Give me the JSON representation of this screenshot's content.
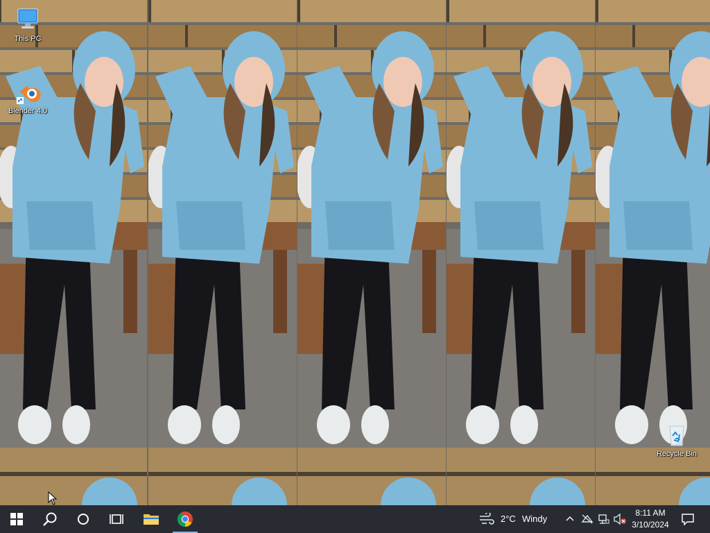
{
  "desktop": {
    "icons": [
      {
        "label": "This PC",
        "icon": "this-pc-icon"
      },
      {
        "label": "Blender 4.0",
        "icon": "blender-icon"
      },
      {
        "label": "Recycle Bin",
        "icon": "recycle-bin-icon"
      }
    ]
  },
  "taskbar": {
    "pinned": [
      {
        "name": "start-button",
        "icon": "windows-logo-icon"
      },
      {
        "name": "search-button",
        "icon": "search-icon"
      },
      {
        "name": "cortana-button",
        "icon": "cortana-circle-icon"
      },
      {
        "name": "task-view-button",
        "icon": "task-view-icon"
      },
      {
        "name": "file-explorer-button",
        "icon": "folder-icon"
      },
      {
        "name": "chrome-button",
        "icon": "chrome-icon"
      }
    ],
    "weather": {
      "temperature": "2°C",
      "condition": "Windy"
    },
    "clock": {
      "time": "8:11 AM",
      "date": "3/10/2024"
    }
  },
  "colors": {
    "taskbar": "#1e2530",
    "hoodie": "#7fb9d9",
    "leggings": "#15151a",
    "shoes": "#e9ecec",
    "wood": "#b08a55",
    "chrome_red": "#db4437",
    "chrome_yellow": "#f4c20d",
    "chrome_green": "#0f9d58",
    "chrome_blue": "#4285f4",
    "folder": "#f2c14e"
  }
}
